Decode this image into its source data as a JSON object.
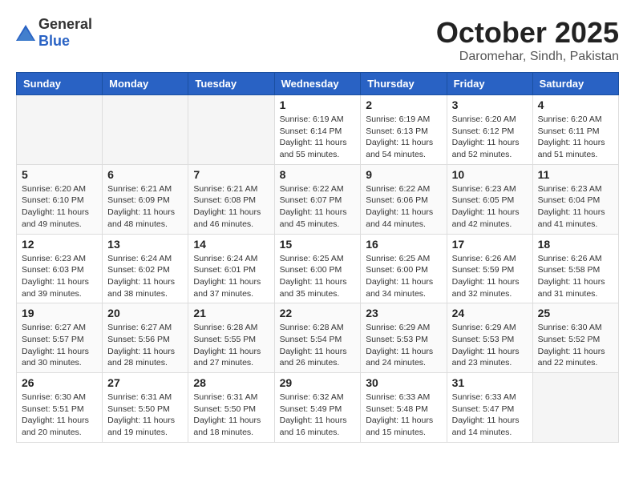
{
  "logo": {
    "general": "General",
    "blue": "Blue"
  },
  "header": {
    "month": "October 2025",
    "location": "Daromehar, Sindh, Pakistan"
  },
  "weekdays": [
    "Sunday",
    "Monday",
    "Tuesday",
    "Wednesday",
    "Thursday",
    "Friday",
    "Saturday"
  ],
  "weeks": [
    [
      {
        "day": "",
        "info": ""
      },
      {
        "day": "",
        "info": ""
      },
      {
        "day": "",
        "info": ""
      },
      {
        "day": "1",
        "info": "Sunrise: 6:19 AM\nSunset: 6:14 PM\nDaylight: 11 hours\nand 55 minutes."
      },
      {
        "day": "2",
        "info": "Sunrise: 6:19 AM\nSunset: 6:13 PM\nDaylight: 11 hours\nand 54 minutes."
      },
      {
        "day": "3",
        "info": "Sunrise: 6:20 AM\nSunset: 6:12 PM\nDaylight: 11 hours\nand 52 minutes."
      },
      {
        "day": "4",
        "info": "Sunrise: 6:20 AM\nSunset: 6:11 PM\nDaylight: 11 hours\nand 51 minutes."
      }
    ],
    [
      {
        "day": "5",
        "info": "Sunrise: 6:20 AM\nSunset: 6:10 PM\nDaylight: 11 hours\nand 49 minutes."
      },
      {
        "day": "6",
        "info": "Sunrise: 6:21 AM\nSunset: 6:09 PM\nDaylight: 11 hours\nand 48 minutes."
      },
      {
        "day": "7",
        "info": "Sunrise: 6:21 AM\nSunset: 6:08 PM\nDaylight: 11 hours\nand 46 minutes."
      },
      {
        "day": "8",
        "info": "Sunrise: 6:22 AM\nSunset: 6:07 PM\nDaylight: 11 hours\nand 45 minutes."
      },
      {
        "day": "9",
        "info": "Sunrise: 6:22 AM\nSunset: 6:06 PM\nDaylight: 11 hours\nand 44 minutes."
      },
      {
        "day": "10",
        "info": "Sunrise: 6:23 AM\nSunset: 6:05 PM\nDaylight: 11 hours\nand 42 minutes."
      },
      {
        "day": "11",
        "info": "Sunrise: 6:23 AM\nSunset: 6:04 PM\nDaylight: 11 hours\nand 41 minutes."
      }
    ],
    [
      {
        "day": "12",
        "info": "Sunrise: 6:23 AM\nSunset: 6:03 PM\nDaylight: 11 hours\nand 39 minutes."
      },
      {
        "day": "13",
        "info": "Sunrise: 6:24 AM\nSunset: 6:02 PM\nDaylight: 11 hours\nand 38 minutes."
      },
      {
        "day": "14",
        "info": "Sunrise: 6:24 AM\nSunset: 6:01 PM\nDaylight: 11 hours\nand 37 minutes."
      },
      {
        "day": "15",
        "info": "Sunrise: 6:25 AM\nSunset: 6:00 PM\nDaylight: 11 hours\nand 35 minutes."
      },
      {
        "day": "16",
        "info": "Sunrise: 6:25 AM\nSunset: 6:00 PM\nDaylight: 11 hours\nand 34 minutes."
      },
      {
        "day": "17",
        "info": "Sunrise: 6:26 AM\nSunset: 5:59 PM\nDaylight: 11 hours\nand 32 minutes."
      },
      {
        "day": "18",
        "info": "Sunrise: 6:26 AM\nSunset: 5:58 PM\nDaylight: 11 hours\nand 31 minutes."
      }
    ],
    [
      {
        "day": "19",
        "info": "Sunrise: 6:27 AM\nSunset: 5:57 PM\nDaylight: 11 hours\nand 30 minutes."
      },
      {
        "day": "20",
        "info": "Sunrise: 6:27 AM\nSunset: 5:56 PM\nDaylight: 11 hours\nand 28 minutes."
      },
      {
        "day": "21",
        "info": "Sunrise: 6:28 AM\nSunset: 5:55 PM\nDaylight: 11 hours\nand 27 minutes."
      },
      {
        "day": "22",
        "info": "Sunrise: 6:28 AM\nSunset: 5:54 PM\nDaylight: 11 hours\nand 26 minutes."
      },
      {
        "day": "23",
        "info": "Sunrise: 6:29 AM\nSunset: 5:53 PM\nDaylight: 11 hours\nand 24 minutes."
      },
      {
        "day": "24",
        "info": "Sunrise: 6:29 AM\nSunset: 5:53 PM\nDaylight: 11 hours\nand 23 minutes."
      },
      {
        "day": "25",
        "info": "Sunrise: 6:30 AM\nSunset: 5:52 PM\nDaylight: 11 hours\nand 22 minutes."
      }
    ],
    [
      {
        "day": "26",
        "info": "Sunrise: 6:30 AM\nSunset: 5:51 PM\nDaylight: 11 hours\nand 20 minutes."
      },
      {
        "day": "27",
        "info": "Sunrise: 6:31 AM\nSunset: 5:50 PM\nDaylight: 11 hours\nand 19 minutes."
      },
      {
        "day": "28",
        "info": "Sunrise: 6:31 AM\nSunset: 5:50 PM\nDaylight: 11 hours\nand 18 minutes."
      },
      {
        "day": "29",
        "info": "Sunrise: 6:32 AM\nSunset: 5:49 PM\nDaylight: 11 hours\nand 16 minutes."
      },
      {
        "day": "30",
        "info": "Sunrise: 6:33 AM\nSunset: 5:48 PM\nDaylight: 11 hours\nand 15 minutes."
      },
      {
        "day": "31",
        "info": "Sunrise: 6:33 AM\nSunset: 5:47 PM\nDaylight: 11 hours\nand 14 minutes."
      },
      {
        "day": "",
        "info": ""
      }
    ]
  ]
}
